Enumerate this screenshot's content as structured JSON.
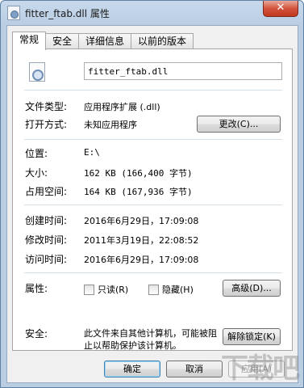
{
  "window": {
    "title": "fitter_ftab.dll 属性",
    "close_label": "✕"
  },
  "tabs": [
    {
      "label": "常规"
    },
    {
      "label": "安全"
    },
    {
      "label": "详细信息"
    },
    {
      "label": "以前的版本"
    }
  ],
  "general": {
    "filename": "fitter_ftab.dll",
    "file_type_label": "文件类型:",
    "file_type_value": "应用程序扩展 (.dll)",
    "open_with_label": "打开方式:",
    "open_with_value": "未知应用程序",
    "change_button": "更改(C)...",
    "location_label": "位置:",
    "location_value": "E:\\",
    "size_label": "大小:",
    "size_value": "162 KB (166,400 字节)",
    "size_on_disk_label": "占用空间:",
    "size_on_disk_value": "164 KB (167,936 字节)",
    "created_label": "创建时间:",
    "created_value": "2016年6月29日，17:09:08",
    "modified_label": "修改时间:",
    "modified_value": "2011年3月19日，22:08:52",
    "accessed_label": "访问时间:",
    "accessed_value": "2016年6月29日，17:09:08",
    "attributes_label": "属性:",
    "readonly_label": "只读(R)",
    "hidden_label": "隐藏(H)",
    "advanced_button": "高级(D)...",
    "security_label": "安全:",
    "security_text": "此文件来自其他计算机，可能被阻止以帮助保护该计算机。",
    "unblock_button": "解除锁定(K)"
  },
  "footer": {
    "ok_button": "确定",
    "cancel_button": "取消",
    "apply_button": "应用(A)"
  },
  "watermark": "下载吧"
}
